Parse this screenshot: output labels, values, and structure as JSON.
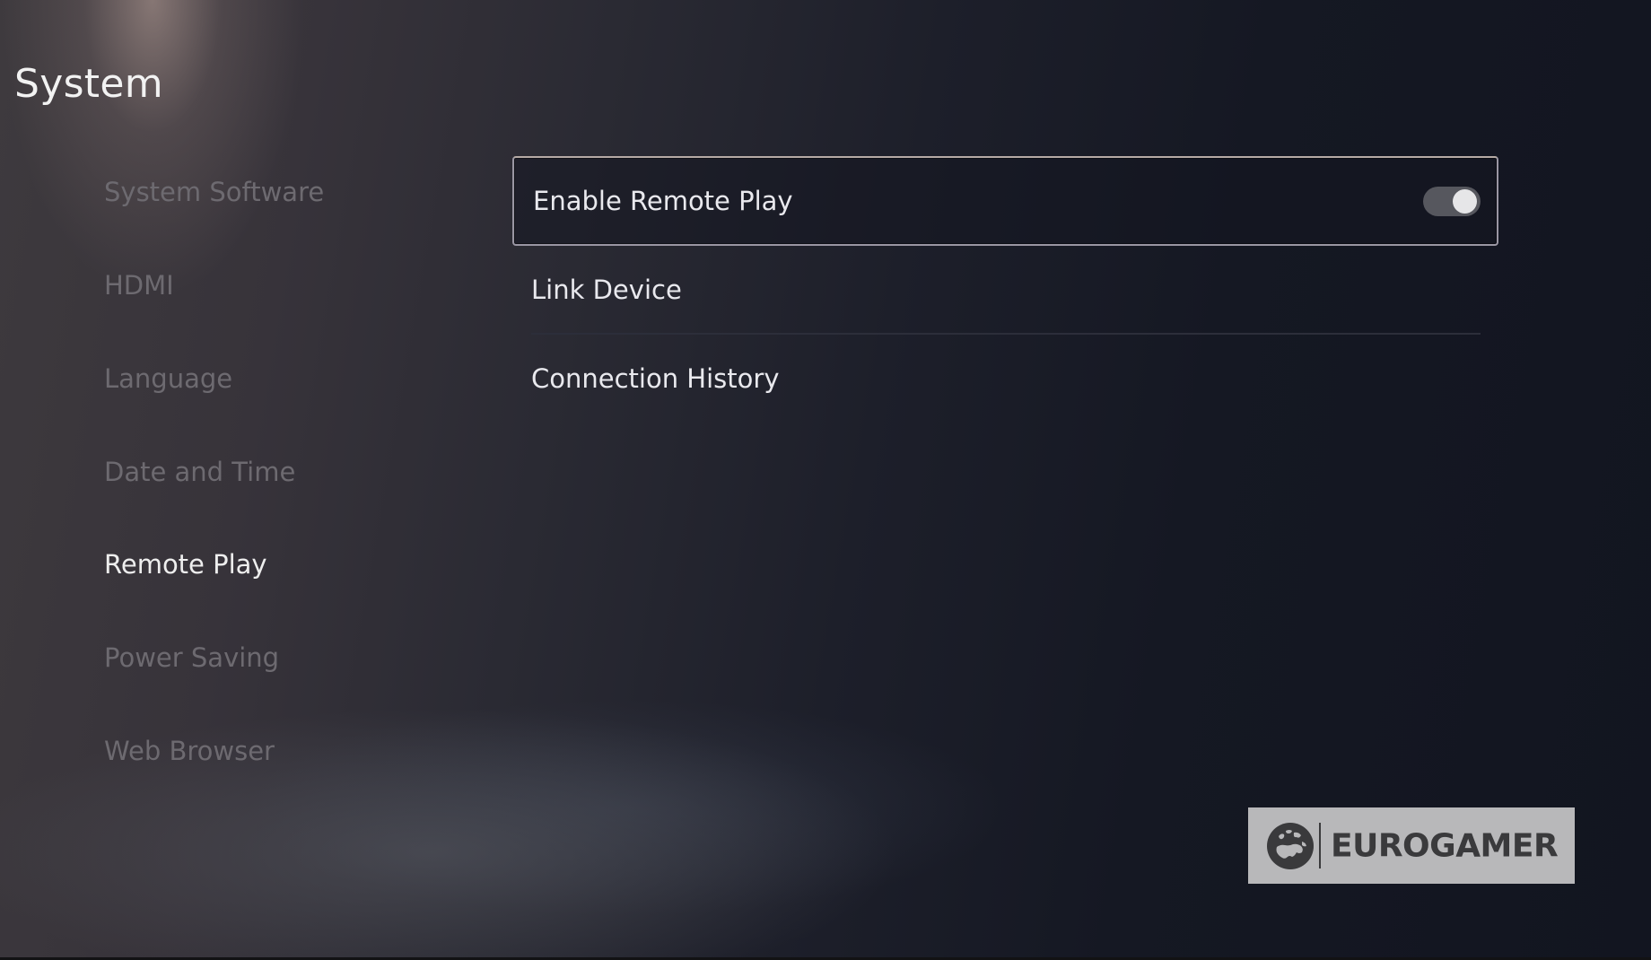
{
  "header": {
    "title": "System"
  },
  "sidebar": {
    "items": [
      {
        "label": "System Software",
        "active": false
      },
      {
        "label": "HDMI",
        "active": false
      },
      {
        "label": "Language",
        "active": false
      },
      {
        "label": "Date and Time",
        "active": false
      },
      {
        "label": "Remote Play",
        "active": true
      },
      {
        "label": "Power Saving",
        "active": false
      },
      {
        "label": "Web Browser",
        "active": false
      }
    ]
  },
  "main": {
    "section": "Remote Play",
    "rows": [
      {
        "label": "Enable Remote Play",
        "type": "toggle",
        "value": "on",
        "selected": true
      },
      {
        "label": "Link Device",
        "type": "link",
        "selected": false
      },
      {
        "label": "Connection History",
        "type": "link",
        "selected": false
      }
    ]
  },
  "watermark": {
    "text": "EUROGAMER",
    "icon": "globe-europe-icon"
  },
  "colors": {
    "text_primary": "#eeeeee",
    "text_inactive": "#6d6a70",
    "background_dark": "#151823",
    "selection_border": "#9a96a3",
    "toggle_track": "#56575e",
    "toggle_knob": "#e6e6e8",
    "watermark_bg": "#b8b8ba"
  }
}
